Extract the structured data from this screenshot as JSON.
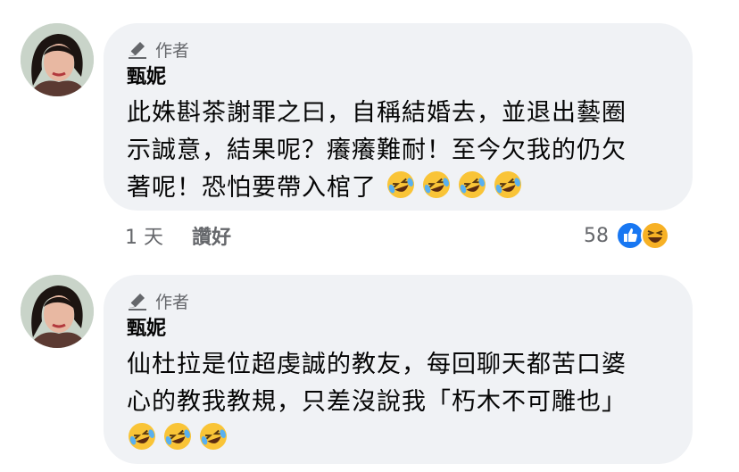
{
  "comments": [
    {
      "author_badge": "作者",
      "name": "甄妮",
      "lines": [
        "此姝斟茶謝罪之曰，自稱結婚去，並退出藝圈",
        "示誠意，結果呢？癢癢難耐！至今欠我的仍欠",
        "著呢！恐怕要帶入棺了"
      ],
      "trailing_emoji": [
        "rofl-emoji",
        "rofl-emoji",
        "rofl-emoji",
        "rofl-emoji"
      ],
      "time": "1 天",
      "like_label": "讚好",
      "reaction_count": "58",
      "reaction_icons": [
        "like-reaction-icon",
        "haha-reaction-icon"
      ]
    },
    {
      "author_badge": "作者",
      "name": "甄妮",
      "lines": [
        "仙杜拉是位超虔誠的教友，每回聊天都苦口婆",
        "心的教我教規，只差沒說我「朽木不可雕也」"
      ],
      "trailing_emoji": [
        "rofl-emoji",
        "rofl-emoji",
        "rofl-emoji"
      ]
    }
  ],
  "colors": {
    "bubble": "#f0f2f5",
    "secondary_text": "#65676b",
    "like_blue": "#1877f2",
    "haha_yellow": "#f7b125"
  }
}
